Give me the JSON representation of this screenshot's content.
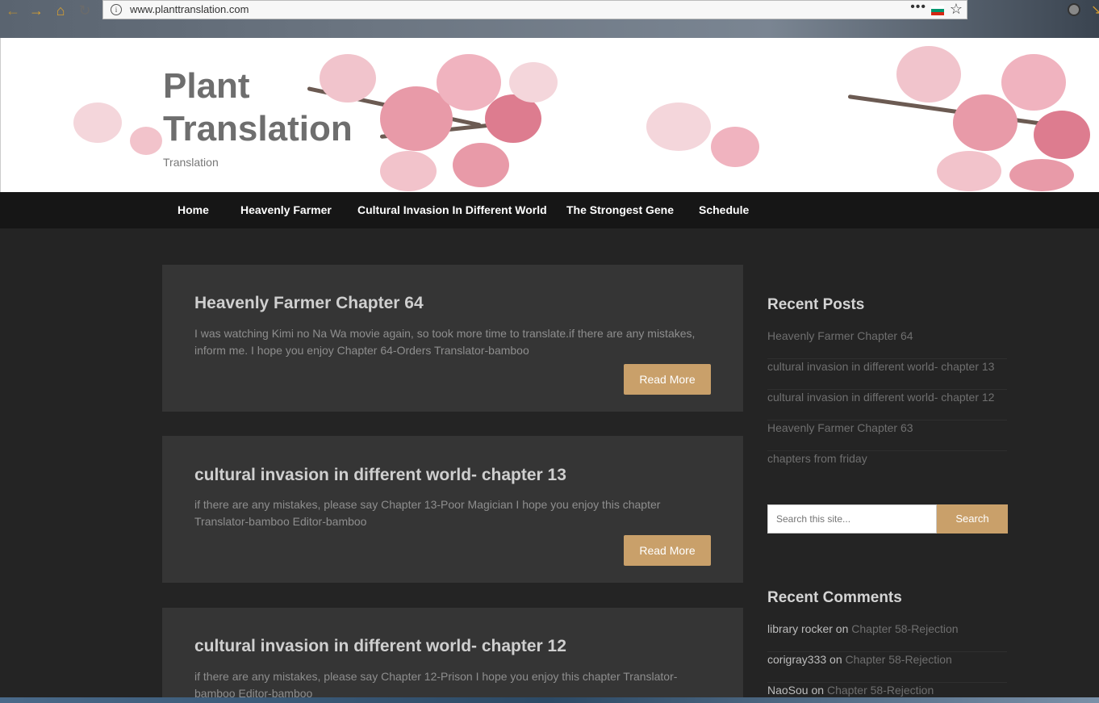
{
  "browser": {
    "url": "www.planttranslation.com",
    "back_icon": "arrow-left-icon",
    "forward_icon": "arrow-right-icon",
    "home_icon": "home-icon",
    "reload_icon": "reload-icon",
    "menu_dots": "•••",
    "accent_color": "#d9a030"
  },
  "header": {
    "title_line1": "Plant",
    "title_line2": "Translation",
    "tagline": "Translation"
  },
  "nav": {
    "items": [
      "Home",
      "Heavenly Farmer",
      "Cultural Invasion In Different World",
      "The Strongest Gene",
      "Schedule"
    ]
  },
  "posts": [
    {
      "title": "Heavenly Farmer Chapter 64",
      "excerpt": "  I was watching Kimi no Na Wa movie again, so took more time to translate.if there are any mistakes, inform me. I hope you enjoy Chapter 64-Orders   Translator-bamboo",
      "button": "Read More"
    },
    {
      "title": "cultural invasion in different world- chapter 13",
      "excerpt": "  if there are any mistakes, please say Chapter 13-Poor Magician I hope you enjoy this chapter Translator-bamboo Editor-bamboo",
      "button": "Read More"
    },
    {
      "title": "cultural invasion in different world- chapter 12",
      "excerpt": "  if there are any mistakes, please say Chapter 12-Prison   I hope you enjoy this chapter Translator-bamboo Editor-bamboo",
      "button": "Read More"
    }
  ],
  "sidebar": {
    "recent_posts_title": "Recent Posts",
    "recent_posts": [
      "Heavenly Farmer Chapter 64",
      "cultural invasion in different world- chapter 13",
      "cultural invasion in different world- chapter 12",
      "Heavenly Farmer Chapter 63",
      "chapters from friday"
    ],
    "search_placeholder": "Search this site...",
    "search_button": "Search",
    "recent_comments_title": "Recent Comments",
    "recent_comments": [
      {
        "author": "library rocker",
        "on": "on",
        "post": "Chapter 58-Rejection"
      },
      {
        "author": "corigray333",
        "on": "on",
        "post": "Chapter 58-Rejection"
      },
      {
        "author": "NaoSou",
        "on": "on",
        "post": "Chapter 58-Rejection"
      }
    ]
  },
  "colors": {
    "page_bg": "#242424",
    "card_bg": "#353535",
    "nav_bg": "#161616",
    "button_bg": "#c9a06a"
  }
}
